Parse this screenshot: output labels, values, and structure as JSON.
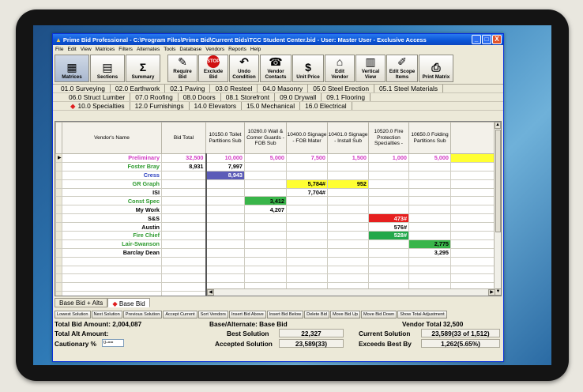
{
  "window": {
    "title": "Prime Bid Professional - C:\\Program Files\\Prime Bid\\Current Bids\\TCC Student Center.bid - User: Master User - Exclusive Access",
    "controls": [
      "_",
      "□",
      "X"
    ]
  },
  "menu": [
    "File",
    "Edit",
    "View",
    "Matrices",
    "Filters",
    "Alternates",
    "Tools",
    "Database",
    "Vendors",
    "Reports",
    "Help"
  ],
  "toolbar": [
    {
      "label": "Matrices",
      "icon": "matrices-icon",
      "glyph": "▦"
    },
    {
      "label": "Sections",
      "icon": "sections-icon",
      "glyph": "▤"
    },
    {
      "label": "Summary",
      "icon": "summary-icon",
      "glyph": "Σ"
    },
    {
      "label": "Require Bid",
      "icon": "require-bid-icon",
      "glyph": "✎"
    },
    {
      "label": "Exclude Bid",
      "icon": "stop-icon",
      "glyph": "STOP"
    },
    {
      "label": "Undo Condition",
      "icon": "undo-icon",
      "glyph": "↶"
    },
    {
      "label": "Vendor Contacts",
      "icon": "contacts-icon",
      "glyph": "☎"
    },
    {
      "label": "Unit Price",
      "icon": "unit-price-icon",
      "glyph": "$"
    },
    {
      "label": "Edit Vendor",
      "icon": "edit-vendor-icon",
      "glyph": "⌂"
    },
    {
      "label": "Vertical View",
      "icon": "vertical-view-icon",
      "glyph": "▥"
    },
    {
      "label": "Edit Scope Items",
      "icon": "edit-scope-icon",
      "glyph": "✐"
    },
    {
      "label": "Print Matrix",
      "icon": "print-icon",
      "glyph": "⎙"
    }
  ],
  "section_tabs": [
    [
      "01.0 Surveying",
      "02.0 Earthwork",
      "02.1 Paving",
      "03.0 Resteel",
      "04.0 Masonry",
      "05.0 Steel Erection",
      "05.1 Steel Materials"
    ],
    [
      "06.0 Struct Lumber",
      "07.0 Roofing",
      "08.0 Doors",
      "08.1 Storefront",
      "09.0 Drywall",
      "09.1 Flooring"
    ],
    [
      "10.0 Specialties",
      "12.0 Furnishings",
      "14.0 Elevators",
      "15.0 Mechanical",
      "16.0 Electrical"
    ]
  ],
  "active_tab": "10.0 Specialties",
  "grid": {
    "headers": [
      "Vendor's Name",
      "Bid Total",
      "10150.0 Toilet Partitions Sub",
      "10260.0 Wall & Corner Guards - FOB Sub",
      "10400.0 Signage - FOB Mater",
      "10401.0 Signage - Install Sub",
      "10520.0 Fire Protection Specialties -",
      "10650.0 Folding Partitions Sub"
    ],
    "rows": [
      {
        "name": "Preliminary",
        "nameColor": "#d23bc4",
        "cells": [
          "32,500",
          "10,000",
          "5,000",
          "7,500",
          "1,500",
          "1,000",
          "5,000"
        ],
        "rowColor": "#d23bc4",
        "selected": true
      },
      {
        "name": "Foster Bray",
        "nameColor": "#2e9a2e",
        "cells": [
          "8,931",
          "7,997",
          "",
          "",
          "",
          "",
          ""
        ]
      },
      {
        "name": "Cress",
        "nameColor": "#2b3fbf",
        "cells": [
          "",
          "8,943",
          "",
          "",
          "",
          "",
          ""
        ]
      },
      {
        "name": "GR Graph",
        "nameColor": "#2e9a2e",
        "cells": [
          "",
          "",
          "",
          "5,784#",
          "952",
          "",
          ""
        ]
      },
      {
        "name": "ISI",
        "nameColor": "#000000",
        "cells": [
          "",
          "",
          "",
          "7,704#",
          "",
          "",
          ""
        ]
      },
      {
        "name": "Const Spec",
        "nameColor": "#2e9a2e",
        "cells": [
          "",
          "",
          "3,412",
          "",
          "",
          "",
          ""
        ]
      },
      {
        "name": "My Work",
        "nameColor": "#000000",
        "cells": [
          "",
          "",
          "4,207",
          "",
          "",
          "",
          ""
        ]
      },
      {
        "name": "S&S",
        "nameColor": "#000000",
        "cells": [
          "",
          "",
          "",
          "",
          "",
          "473#",
          ""
        ]
      },
      {
        "name": "Austin",
        "nameColor": "#000000",
        "cells": [
          "",
          "",
          "",
          "",
          "",
          "576#",
          ""
        ]
      },
      {
        "name": "Fire Chief",
        "nameColor": "#2e9a2e",
        "cells": [
          "",
          "",
          "",
          "",
          "",
          "528#",
          ""
        ]
      },
      {
        "name": "Lair-Swanson",
        "nameColor": "#2e9a2e",
        "cells": [
          "",
          "",
          "",
          "",
          "",
          "",
          "2,775"
        ]
      },
      {
        "name": "Barclay Dean",
        "nameColor": "#000000",
        "cells": [
          "",
          "",
          "",
          "",
          "",
          "",
          "3,295"
        ]
      },
      {
        "name": "",
        "cells": [
          "",
          "",
          "",
          "",
          "",
          "",
          ""
        ]
      },
      {
        "name": "",
        "cells": [
          "",
          "",
          "",
          "",
          "",
          "",
          ""
        ]
      },
      {
        "name": "",
        "cells": [
          "",
          "",
          "",
          "",
          "",
          "",
          ""
        ]
      },
      {
        "name": "",
        "cells": [
          "",
          "",
          "",
          "",
          "",
          "",
          ""
        ]
      },
      {
        "name": "",
        "cells": [
          "",
          "",
          "",
          "",
          "",
          "",
          ""
        ]
      }
    ],
    "highlights": [
      {
        "row": 2,
        "col": 1,
        "bg": "#5b5bb8",
        "fg": "#ffffff"
      },
      {
        "row": 3,
        "col": 3,
        "bg": "#ffff33",
        "fg": "#000000"
      },
      {
        "row": 3,
        "col": 4,
        "bg": "#ffff33",
        "fg": "#000000"
      },
      {
        "row": 5,
        "col": 2,
        "bg": "#39b54a",
        "fg": "#000000"
      },
      {
        "row": 7,
        "col": 5,
        "bg": "#e62020",
        "fg": "#ffffff"
      },
      {
        "row": 9,
        "col": 5,
        "bg": "#22a84a",
        "fg": "#ffffff"
      },
      {
        "row": 10,
        "col": 6,
        "bg": "#39b54a",
        "fg": "#000000"
      },
      {
        "row": 0,
        "col": 7,
        "bg": "#ffff33",
        "fg": "#000000"
      }
    ]
  },
  "bottom_tabs": [
    "Base Bid + Alts",
    "Base Bid"
  ],
  "active_bottom_tab": "Base Bid",
  "buttons": [
    "Lowest Solution",
    "Next Solution",
    "Previous Solution",
    "Accept Current",
    "Sort Vendors",
    "Insert Bid Above",
    "Insert Bid Below",
    "Delete Bid",
    "Move Bid Up",
    "Move Bid Down",
    "Show Total Adjustment"
  ],
  "summary": {
    "total_bid": "Total Bid Amount: 2,004,087",
    "base_alt": "Base/Alternate: Base Bid",
    "vendor_total": "Vendor Total  32,500",
    "total_alt": "Total Alt Amount:",
    "best_solution_label": "Best Solution",
    "best_solution_value": "22,327",
    "current_solution_label": "Current Solution",
    "current_solution_value": "23,589(33 of 1,512)",
    "cautionary_label": "Cautionary %",
    "cautionary_value": "0-==",
    "accepted_solution_label": "Accepted Solution",
    "accepted_solution_value": "23,589(33)",
    "exceeds_label": "Exceeds Best By",
    "exceeds_value": "1,262(5.65%)"
  },
  "colors": {
    "titlebar": "#0a54d6",
    "window_bg": "#ece9d8",
    "diamond": "#e02020"
  }
}
